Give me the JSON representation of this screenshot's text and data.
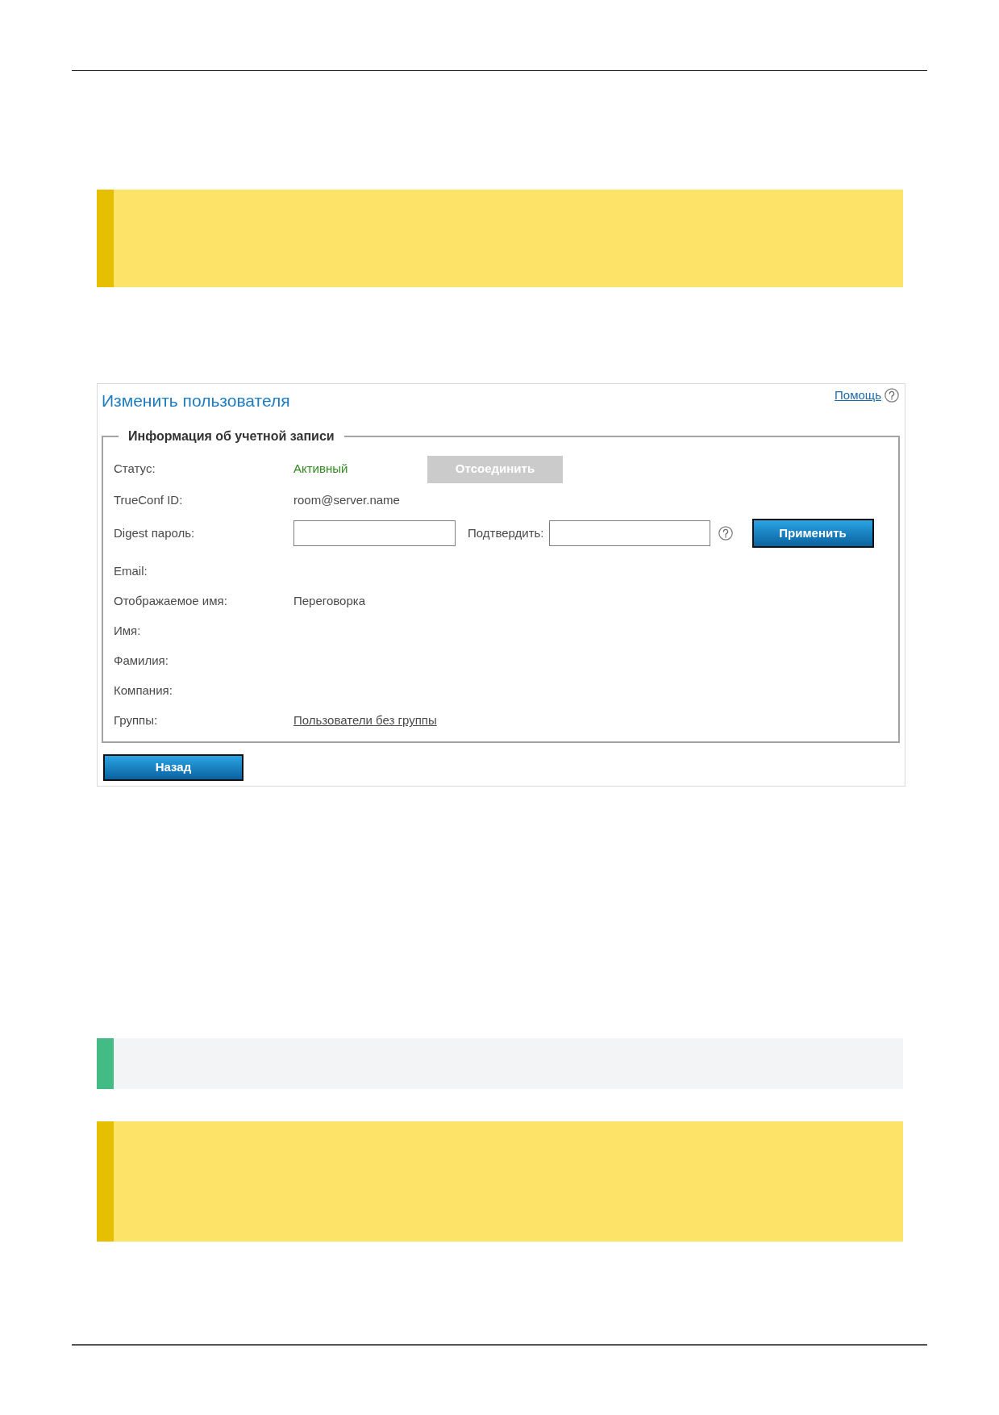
{
  "callouts_before": [
    {
      "kind": "warning"
    }
  ],
  "panel": {
    "title": "Изменить пользователя",
    "help_link": "Помощь",
    "fieldset": {
      "legend": "Информация об учетной записи",
      "rows": [
        {
          "kind": "status",
          "label": "Статус:",
          "value": "Активный",
          "button": {
            "label": "Отсоединить",
            "disabled": true
          }
        },
        {
          "kind": "text",
          "label": "TrueConf ID:",
          "value": "room@server.name"
        },
        {
          "kind": "password",
          "label": "Digest пароль:",
          "confirm_label": "Подтвердить:",
          "button": {
            "label": "Применить",
            "disabled": false
          }
        },
        {
          "kind": "text",
          "label": "Email:"
        },
        {
          "kind": "text",
          "label": "Отображаемое имя:",
          "value": "Переговорка"
        },
        {
          "kind": "text",
          "label": "Имя:"
        },
        {
          "kind": "text",
          "label": "Фамилия:"
        },
        {
          "kind": "text",
          "label": "Компания:"
        },
        {
          "kind": "link",
          "label": "Группы:",
          "value": "Пользователи без группы"
        }
      ]
    },
    "back_button": {
      "label": "Назад",
      "disabled": false
    }
  },
  "callouts_after": [
    {
      "kind": "note"
    },
    {
      "kind": "warning"
    }
  ]
}
